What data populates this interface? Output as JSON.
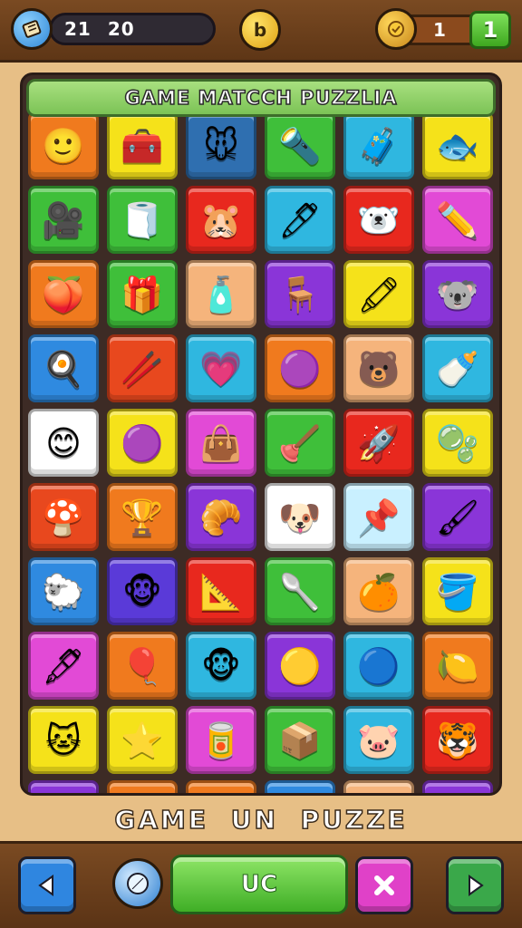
{
  "topbar": {
    "score_a": "21",
    "score_b": "20",
    "coin_label": "b",
    "level_value": "1",
    "plus_label": "1",
    "menu_icon": "scroll-icon",
    "medal_icon": "medal-icon"
  },
  "board": {
    "title": "GAME MATCCH PUZZLIA",
    "tiles": [
      {
        "color": "#f07a1e",
        "icon": "🙂"
      },
      {
        "color": "#f5e21a",
        "icon": "🧰"
      },
      {
        "color": "#2f6fb0",
        "icon": "🐭"
      },
      {
        "color": "#3fbf3a",
        "icon": "🔦"
      },
      {
        "color": "#2fb7e0",
        "icon": "🧳"
      },
      {
        "color": "#f5e21a",
        "icon": "🐟"
      },
      {
        "color": "#3fbf3a",
        "icon": "🎥"
      },
      {
        "color": "#3fbf3a",
        "icon": "🧻"
      },
      {
        "color": "#e8281e",
        "icon": "🐹"
      },
      {
        "color": "#2fb7e0",
        "icon": "🖊"
      },
      {
        "color": "#e8281e",
        "icon": "🐻‍❄️"
      },
      {
        "color": "#e24ad6",
        "icon": "✏️"
      },
      {
        "color": "#f07a1e",
        "icon": "🍑"
      },
      {
        "color": "#3fbf3a",
        "icon": "🎁"
      },
      {
        "color": "#f5b47c",
        "icon": "🧴"
      },
      {
        "color": "#8a35d8",
        "icon": "🪑"
      },
      {
        "color": "#f5e21a",
        "icon": "🖍"
      },
      {
        "color": "#8a35d8",
        "icon": "🐨"
      },
      {
        "color": "#2f8ae0",
        "icon": "🍳"
      },
      {
        "color": "#e8481e",
        "icon": "🥢"
      },
      {
        "color": "#2fb7e0",
        "icon": "💗"
      },
      {
        "color": "#f07a1e",
        "icon": "🟣"
      },
      {
        "color": "#f5b47c",
        "icon": "🐻"
      },
      {
        "color": "#2fb7e0",
        "icon": "🍼"
      },
      {
        "color": "#ffffff",
        "icon": "😊"
      },
      {
        "color": "#f5e21a",
        "icon": "🟣"
      },
      {
        "color": "#e24ad6",
        "icon": "👜"
      },
      {
        "color": "#3fbf3a",
        "icon": "🪠"
      },
      {
        "color": "#e8281e",
        "icon": "🚀"
      },
      {
        "color": "#f5e21a",
        "icon": "🫧"
      },
      {
        "color": "#e8481e",
        "icon": "🍄"
      },
      {
        "color": "#f07a1e",
        "icon": "🏆"
      },
      {
        "color": "#8a35d8",
        "icon": "🥐"
      },
      {
        "color": "#ffffff",
        "icon": "🐶"
      },
      {
        "color": "#c9f0ff",
        "icon": "📌"
      },
      {
        "color": "#8a35d8",
        "icon": "🖌"
      },
      {
        "color": "#2f8ae0",
        "icon": "🐑"
      },
      {
        "color": "#5a3ad8",
        "icon": "🐵"
      },
      {
        "color": "#e8281e",
        "icon": "📐"
      },
      {
        "color": "#3fbf3a",
        "icon": "🥄"
      },
      {
        "color": "#f5b47c",
        "icon": "🍊"
      },
      {
        "color": "#f5e21a",
        "icon": "🪣"
      },
      {
        "color": "#e24ad6",
        "icon": "🖋"
      },
      {
        "color": "#f07a1e",
        "icon": "🎈"
      },
      {
        "color": "#2fb7e0",
        "icon": "🐵"
      },
      {
        "color": "#8a35d8",
        "icon": "🟡"
      },
      {
        "color": "#2fb7e0",
        "icon": "🔵"
      },
      {
        "color": "#f07a1e",
        "icon": "🍋"
      },
      {
        "color": "#f5e21a",
        "icon": "🐱"
      },
      {
        "color": "#f5e21a",
        "icon": "⭐"
      },
      {
        "color": "#e24ad6",
        "icon": "🥫"
      },
      {
        "color": "#3fbf3a",
        "icon": "📦"
      },
      {
        "color": "#2fb7e0",
        "icon": "🐷"
      },
      {
        "color": "#e8281e",
        "icon": "🐯"
      },
      {
        "color": "#8a35d8",
        "icon": "🐻‍❄️"
      },
      {
        "color": "#f07a1e",
        "icon": "🟠"
      },
      {
        "color": "#f07a1e",
        "icon": "🐞"
      },
      {
        "color": "#2f8ae0",
        "icon": "🌕"
      },
      {
        "color": "#f5b47c",
        "icon": "🐸"
      },
      {
        "color": "#8a35d8",
        "icon": "🐭"
      }
    ]
  },
  "caption": "GAME  UN  PUZZE",
  "bottombar": {
    "main_label": "UC",
    "back_icon": "play-left-icon",
    "next_icon": "play-right-icon",
    "close_icon": "close-icon",
    "hint_icon": "compass-icon"
  }
}
